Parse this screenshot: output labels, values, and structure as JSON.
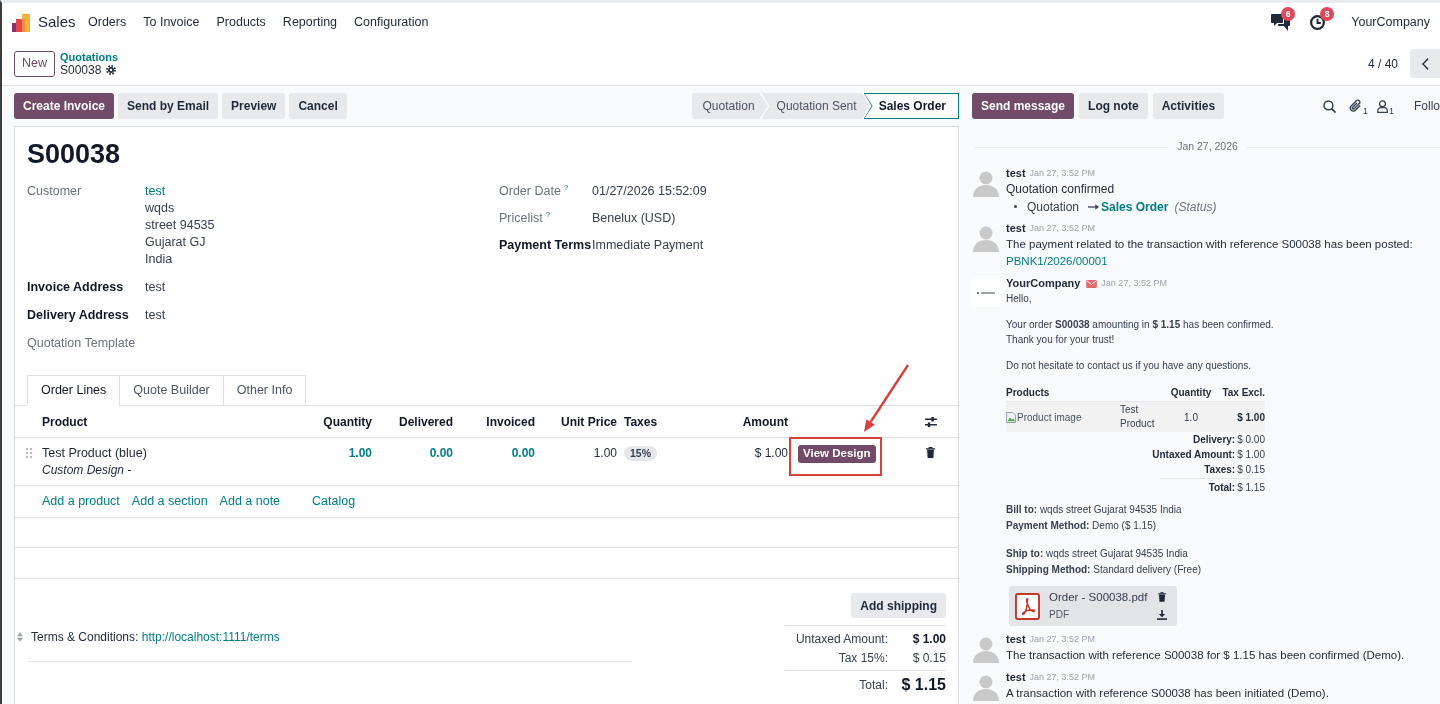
{
  "navbar": {
    "app_name": "Sales",
    "menu": [
      "Orders",
      "To Invoice",
      "Products",
      "Reporting",
      "Configuration"
    ],
    "systray": [
      {
        "kind": "messages",
        "badge": "6"
      },
      {
        "kind": "activities",
        "badge": "8"
      }
    ],
    "company": "YourCompany"
  },
  "control_panel": {
    "new_button": "New",
    "breadcrumb": "Quotations",
    "record_name": "S00038",
    "pager": "4 / 40"
  },
  "action_buttons": [
    {
      "label": "Create Invoice",
      "primary": true
    },
    {
      "label": "Send by Email",
      "primary": false
    },
    {
      "label": "Preview",
      "primary": false
    },
    {
      "label": "Cancel",
      "primary": false
    }
  ],
  "statusbar": [
    {
      "label": "Quotation",
      "selected": false
    },
    {
      "label": "Quotation Sent",
      "selected": false
    },
    {
      "label": "Sales Order",
      "selected": true
    }
  ],
  "form": {
    "title": "S00038",
    "left_fields": [
      {
        "label": "Customer",
        "readonly": true,
        "value": "test",
        "link": true,
        "address": [
          "wqds",
          "street 94535",
          "Gujarat GJ",
          "India"
        ]
      },
      {
        "label": "Invoice Address",
        "readonly": false,
        "value": "test",
        "link": false
      },
      {
        "label": "Delivery Address",
        "readonly": false,
        "value": "test",
        "link": false
      },
      {
        "label": "Quotation Template",
        "readonly": true
      }
    ],
    "right_fields": [
      {
        "label": "Order Date",
        "help": "?",
        "readonly": true,
        "value": "01/27/2026 15:52:09"
      },
      {
        "label": "Pricelist",
        "help": "?",
        "readonly": true,
        "value": "Benelux (USD)"
      },
      {
        "label": "Payment Terms",
        "readonly": false,
        "value": "Immediate Payment"
      }
    ],
    "tabs": [
      {
        "label": "Order Lines",
        "selected": true
      },
      {
        "label": "Quote Builder",
        "selected": false
      },
      {
        "label": "Other Info",
        "selected": false
      }
    ],
    "order_lines": {
      "columns": [
        "Product",
        "Quantity",
        "Delivered",
        "Invoiced",
        "Unit Price",
        "Taxes",
        "Amount"
      ],
      "rows": [
        {
          "product": "Test Product (blue)",
          "description": "Custom Design -",
          "quantity": "1.00",
          "delivered": "0.00",
          "invoiced": "0.00",
          "unit_price": "1.00",
          "taxes": [
            "15%"
          ],
          "amount": "$ 1.00",
          "button": "View Design"
        }
      ],
      "add_links": [
        "Add a product",
        "Add a section",
        "Add a note",
        "Catalog"
      ]
    },
    "add_shipping": "Add shipping",
    "terms": {
      "label": "Terms & Conditions:",
      "link": "http://localhost:1111/terms"
    },
    "totals": [
      {
        "kind": "subtotal",
        "label": "Untaxed Amount:",
        "value": "$ 1.00"
      },
      {
        "kind": "tax",
        "label": "Tax 15%:",
        "value": "$ 0.15"
      },
      {
        "kind": "total",
        "label": "Total:",
        "value": "$ 1.15"
      }
    ]
  },
  "chatter": {
    "buttons": [
      {
        "label": "Send message",
        "primary": true
      },
      {
        "label": "Log note",
        "primary": false
      },
      {
        "label": "Activities",
        "primary": false
      }
    ],
    "attachment_count": "1",
    "follower_count": "1",
    "follow_button": "Follo",
    "date_separator": "Jan 27, 2026",
    "messages": [
      {
        "kind": "tracking",
        "avatar": {
          "kind": "user"
        },
        "author": "test",
        "date": "Jan 27, 3:52 PM",
        "body": "Quotation confirmed",
        "tracking": {
          "old_value": "Quotation",
          "new_value": "Sales Order",
          "field": "(Status)"
        }
      },
      {
        "kind": "note",
        "avatar": {
          "kind": "user"
        },
        "author": "test",
        "date": "Jan 27, 3:52 PM",
        "body": "The payment related to the transaction with reference S00038 has been posted:",
        "link": "PBNK1/2026/00001"
      },
      {
        "kind": "email",
        "avatar": {
          "kind": "company"
        },
        "author": "YourCompany",
        "date": "Jan 27, 3:52 PM",
        "email": {
          "greeting": "Hello,",
          "paragraphs": [
            [
              "Your order **S00038** amounting in **$ 1.15** has been confirmed.",
              "Thank you for your trust!"
            ],
            [
              "Do not hesitate to contact us if you have any questions."
            ]
          ],
          "table": {
            "columns": [
              "Products",
              "Quantity",
              "Tax Excl."
            ],
            "rows": [
              {
                "image_alt": "Product image",
                "name": "Test Product",
                "quantity": "1.0",
                "amount": "$ 1.00"
              }
            ]
          },
          "summary": [
            {
              "kind": "line",
              "label": "Delivery:",
              "value": "$ 0.00"
            },
            {
              "kind": "line",
              "label": "Untaxed Amount:",
              "value": "$ 1.00"
            },
            {
              "kind": "line",
              "label": "Taxes:",
              "value": "$ 0.15"
            },
            {
              "kind": "total",
              "label": "Total:",
              "value": "$ 1.15"
            }
          ],
          "billing": [
            "**Bill to:** wqds street Gujarat 94535 India",
            "**Payment Method:** Demo ($ 1.15)"
          ],
          "shipping": [
            "**Ship to:** wqds street Gujarat 94535 India",
            "**Shipping Method:** Standard delivery (Free)"
          ],
          "attachment": {
            "name": "Order - S00038.pdf",
            "type": "PDF"
          }
        }
      },
      {
        "kind": "note",
        "avatar": {
          "kind": "user"
        },
        "author": "test",
        "date": "Jan 27, 3:52 PM",
        "body": "The transaction with reference S00038 for $ 1.15 has been confirmed (Demo)."
      },
      {
        "kind": "note",
        "avatar": {
          "kind": "user"
        },
        "author": "test",
        "date": "Jan 27, 3:52 PM",
        "body": "A transaction with reference S00038 has been initiated (Demo)."
      }
    ]
  }
}
